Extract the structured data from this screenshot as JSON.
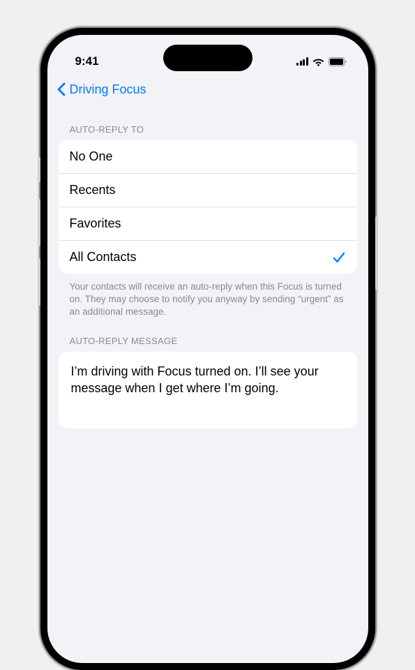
{
  "statusBar": {
    "time": "9:41"
  },
  "nav": {
    "backLabel": "Driving Focus"
  },
  "sections": {
    "autoReplyTo": {
      "header": "AUTO-REPLY TO",
      "options": [
        {
          "label": "No One",
          "selected": false
        },
        {
          "label": "Recents",
          "selected": false
        },
        {
          "label": "Favorites",
          "selected": false
        },
        {
          "label": "All Contacts",
          "selected": true
        }
      ],
      "footer": "Your contacts will receive an auto-reply when this Focus is turned on. They may choose to notify you anyway by sending “urgent” as an additional message."
    },
    "autoReplyMessage": {
      "header": "AUTO-REPLY MESSAGE",
      "value": "I’m driving with Focus turned on. I’ll see your message when I get where I’m going."
    }
  }
}
